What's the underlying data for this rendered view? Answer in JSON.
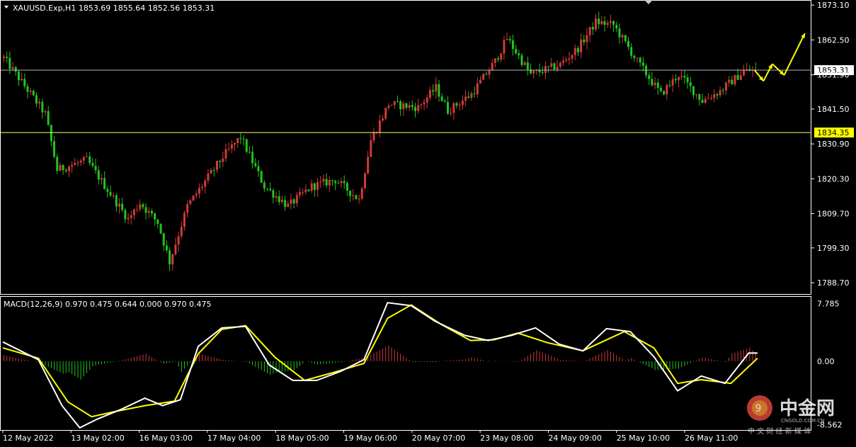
{
  "header": {
    "symbol_line": "XAUUSD.Exp,H1  1853.69 1855.64 1852.56 1853.31",
    "macd_line": "MACD(12,26,9) 0.970 0.475 0.644 0.000 0.970 0.475"
  },
  "colors": {
    "background": "#000000",
    "bull": "#d23a3a",
    "bear": "#22c41f",
    "macd_line": "#ffffff",
    "signal_line": "#ffff00",
    "current_price_line": "#a9b4c2",
    "level_line": "#ffff66",
    "forecast_arrow": "#ffff00",
    "frame": "#ffffff"
  },
  "watermark": {
    "brand": "中金网",
    "domain": "CNGOLD.COM.CN",
    "tagline": "中 文 财 经 新 媒 体",
    "icon": "cngold-logo-icon"
  },
  "chart_data": [
    {
      "type": "candlestick",
      "name": "XAUUSD.Exp,H1",
      "timeframe": "H1",
      "last_bar": {
        "open": 1853.69,
        "high": 1855.64,
        "low": 1852.56,
        "close": 1853.31
      },
      "price_axis_ticks": [
        "1873.10",
        "1862.50",
        "1851.90",
        "1841.50",
        "1830.90",
        "1820.30",
        "1809.70",
        "1799.30",
        "1788.70"
      ],
      "ylim": [
        1785.5,
        1874.2
      ],
      "time_axis_labels": [
        "12 May 2022",
        "13 May 02:00",
        "16 May 03:00",
        "17 May 04:00",
        "18 May 05:00",
        "19 May 06:00",
        "20 May 07:00",
        "23 May 08:00",
        "24 May 09:00",
        "25 May 10:00",
        "26 May 11:00"
      ],
      "horizontal_lines": [
        {
          "label": "1853.31",
          "value": 1853.31,
          "kind": "current_price"
        },
        {
          "label": "1834.35",
          "value": 1834.35,
          "kind": "level"
        }
      ],
      "path_segments": [
        {
          "from": 0,
          "to": 14,
          "start": 1857,
          "end": 1840
        },
        {
          "from": 14,
          "to": 18,
          "start": 1840,
          "end": 1823
        },
        {
          "from": 18,
          "to": 28,
          "start": 1823,
          "end": 1826
        },
        {
          "from": 28,
          "to": 42,
          "start": 1826,
          "end": 1808
        },
        {
          "from": 42,
          "to": 46,
          "start": 1808,
          "end": 1813
        },
        {
          "from": 46,
          "to": 52,
          "start": 1813,
          "end": 1807
        },
        {
          "from": 52,
          "to": 56,
          "start": 1807,
          "end": 1795
        },
        {
          "from": 56,
          "to": 62,
          "start": 1795,
          "end": 1812
        },
        {
          "from": 62,
          "to": 74,
          "start": 1812,
          "end": 1827
        },
        {
          "from": 74,
          "to": 80,
          "start": 1827,
          "end": 1833
        },
        {
          "from": 80,
          "to": 88,
          "start": 1833,
          "end": 1818
        },
        {
          "from": 88,
          "to": 96,
          "start": 1818,
          "end": 1812
        },
        {
          "from": 96,
          "to": 104,
          "start": 1812,
          "end": 1818
        },
        {
          "from": 104,
          "to": 112,
          "start": 1818,
          "end": 1820
        },
        {
          "from": 112,
          "to": 120,
          "start": 1820,
          "end": 1814
        },
        {
          "from": 120,
          "to": 124,
          "start": 1814,
          "end": 1832
        },
        {
          "from": 124,
          "to": 130,
          "start": 1832,
          "end": 1843
        },
        {
          "from": 130,
          "to": 140,
          "start": 1843,
          "end": 1842
        },
        {
          "from": 140,
          "to": 146,
          "start": 1842,
          "end": 1848
        },
        {
          "from": 146,
          "to": 150,
          "start": 1848,
          "end": 1841
        },
        {
          "from": 150,
          "to": 158,
          "start": 1841,
          "end": 1846
        },
        {
          "from": 158,
          "to": 166,
          "start": 1846,
          "end": 1856
        },
        {
          "from": 166,
          "to": 170,
          "start": 1856,
          "end": 1863
        },
        {
          "from": 170,
          "to": 178,
          "start": 1863,
          "end": 1852
        },
        {
          "from": 178,
          "to": 188,
          "start": 1852,
          "end": 1855
        },
        {
          "from": 188,
          "to": 194,
          "start": 1855,
          "end": 1860
        },
        {
          "from": 194,
          "to": 200,
          "start": 1860,
          "end": 1868
        },
        {
          "from": 200,
          "to": 206,
          "start": 1868,
          "end": 1867
        },
        {
          "from": 206,
          "to": 214,
          "start": 1867,
          "end": 1856
        },
        {
          "from": 214,
          "to": 222,
          "start": 1856,
          "end": 1846
        },
        {
          "from": 222,
          "to": 228,
          "start": 1846,
          "end": 1852
        },
        {
          "from": 228,
          "to": 236,
          "start": 1852,
          "end": 1844
        },
        {
          "from": 236,
          "to": 242,
          "start": 1844,
          "end": 1847
        },
        {
          "from": 242,
          "to": 250,
          "start": 1847,
          "end": 1853
        },
        {
          "from": 250,
          "to": 254,
          "start": 1853,
          "end": 1853.31
        }
      ],
      "forecast_path": [
        {
          "t": 254,
          "price": 1853.31
        },
        {
          "t": 257,
          "price": 1850.0
        },
        {
          "t": 260,
          "price": 1855.2
        },
        {
          "t": 264,
          "price": 1851.8
        },
        {
          "t": 271,
          "price": 1864.5
        }
      ]
    },
    {
      "type": "macd",
      "name": "MACD(12,26,9)",
      "values": {
        "macd": 0.97,
        "signal": 0.475,
        "histogram": 0.644
      },
      "ylim": [
        -9.2,
        8.6
      ],
      "axis_ticks": [
        "7.785",
        "0.00",
        "-8.562"
      ],
      "macd_path": [
        [
          0,
          2.6
        ],
        [
          12,
          0.2
        ],
        [
          20,
          -6.0
        ],
        [
          26,
          -9.0
        ],
        [
          32,
          -7.8
        ],
        [
          40,
          -6.5
        ],
        [
          48,
          -5.0
        ],
        [
          54,
          -6.0
        ],
        [
          60,
          -5.2
        ],
        [
          66,
          2.0
        ],
        [
          74,
          4.5
        ],
        [
          82,
          4.7
        ],
        [
          90,
          -0.5
        ],
        [
          98,
          -2.6
        ],
        [
          106,
          -2.6
        ],
        [
          114,
          -1.4
        ],
        [
          122,
          0.2
        ],
        [
          130,
          7.9
        ],
        [
          138,
          7.5
        ],
        [
          146,
          5.4
        ],
        [
          156,
          3.5
        ],
        [
          164,
          2.8
        ],
        [
          172,
          3.5
        ],
        [
          180,
          4.5
        ],
        [
          188,
          2.3
        ],
        [
          196,
          1.4
        ],
        [
          204,
          4.4
        ],
        [
          212,
          4.0
        ],
        [
          220,
          0.6
        ],
        [
          228,
          -4.0
        ],
        [
          236,
          -2.0
        ],
        [
          244,
          -3.0
        ],
        [
          252,
          1.1
        ],
        [
          255,
          1.1
        ]
      ],
      "signal_path": [
        [
          0,
          1.8
        ],
        [
          12,
          0.4
        ],
        [
          22,
          -5.5
        ],
        [
          30,
          -7.5
        ],
        [
          38,
          -6.8
        ],
        [
          48,
          -6.0
        ],
        [
          58,
          -5.4
        ],
        [
          66,
          1.0
        ],
        [
          74,
          4.3
        ],
        [
          82,
          4.8
        ],
        [
          92,
          0.5
        ],
        [
          102,
          -2.6
        ],
        [
          112,
          -1.5
        ],
        [
          122,
          -0.3
        ],
        [
          130,
          5.8
        ],
        [
          138,
          7.6
        ],
        [
          148,
          5.0
        ],
        [
          158,
          2.8
        ],
        [
          166,
          2.9
        ],
        [
          174,
          3.8
        ],
        [
          184,
          2.5
        ],
        [
          196,
          1.4
        ],
        [
          210,
          4.0
        ],
        [
          220,
          1.8
        ],
        [
          228,
          -3.0
        ],
        [
          236,
          -2.5
        ],
        [
          246,
          -3.0
        ],
        [
          255,
          0.4
        ]
      ]
    }
  ]
}
